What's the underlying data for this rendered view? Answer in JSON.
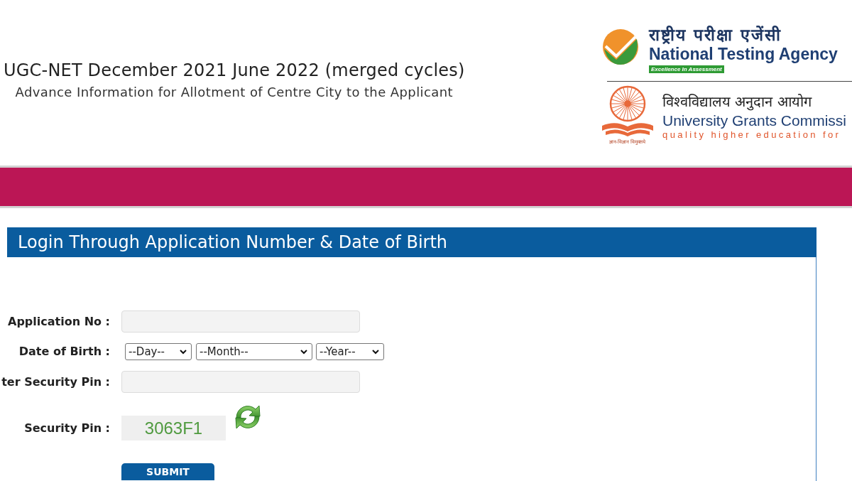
{
  "header": {
    "title": "UGC-NET December 2021 June 2022 (merged cycles)",
    "subtitle": "Advance Information for Allotment of Centre City to the Applicant"
  },
  "logos": {
    "nta": {
      "hindi_name": "राष्ट्रीय परीक्षा एजेंसी",
      "name": "National Testing Agency",
      "tagline": "Excellence In Assessment"
    },
    "ugc": {
      "motto": "ज्ञान-विज्ञान विमुक्तये",
      "hindi_name": "विश्वविद्यालय अनुदान आयोग",
      "name": "University Grants Commissi",
      "tagline": "quality higher education for"
    }
  },
  "login_panel": {
    "title": "Login Through Application Number & Date of Birth",
    "fields": [
      {
        "kind": "text",
        "label": "Application No :"
      },
      {
        "kind": "date",
        "label": "Date of Birth :",
        "selects": [
          {
            "value": "--Day--"
          },
          {
            "value": "--Month--"
          },
          {
            "value": "--Year--"
          }
        ]
      },
      {
        "kind": "text",
        "label": "ter Security Pin :"
      },
      {
        "kind": "captcha",
        "label": "Security Pin :",
        "code": "3063F1"
      }
    ],
    "submit": "SUBMIT"
  }
}
